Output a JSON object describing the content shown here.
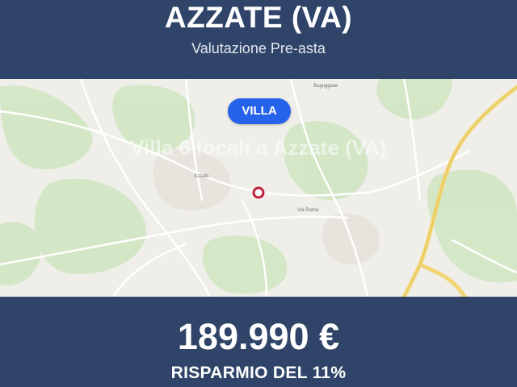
{
  "header": {
    "city": "AZZATE (VA)",
    "subtitle": "Valutazione Pre-asta"
  },
  "map": {
    "property_type_badge": "VILLA",
    "overlay_title": "Villa 6 locali a Azzate (VA)",
    "place_labels": [
      "Buguggiate",
      "Azzate",
      "Via Roma"
    ],
    "pin_icon": "location-pin-icon"
  },
  "footer": {
    "price": "189.990 €",
    "saving": "RISPARMIO DEL 11%"
  },
  "colors": {
    "band_background": "#2f4468",
    "badge_blue": "#2563eb",
    "map_background": "#efeee9",
    "green_area": "#cfe5c1",
    "highway": "#f2d675",
    "pin": "#c0213c"
  }
}
